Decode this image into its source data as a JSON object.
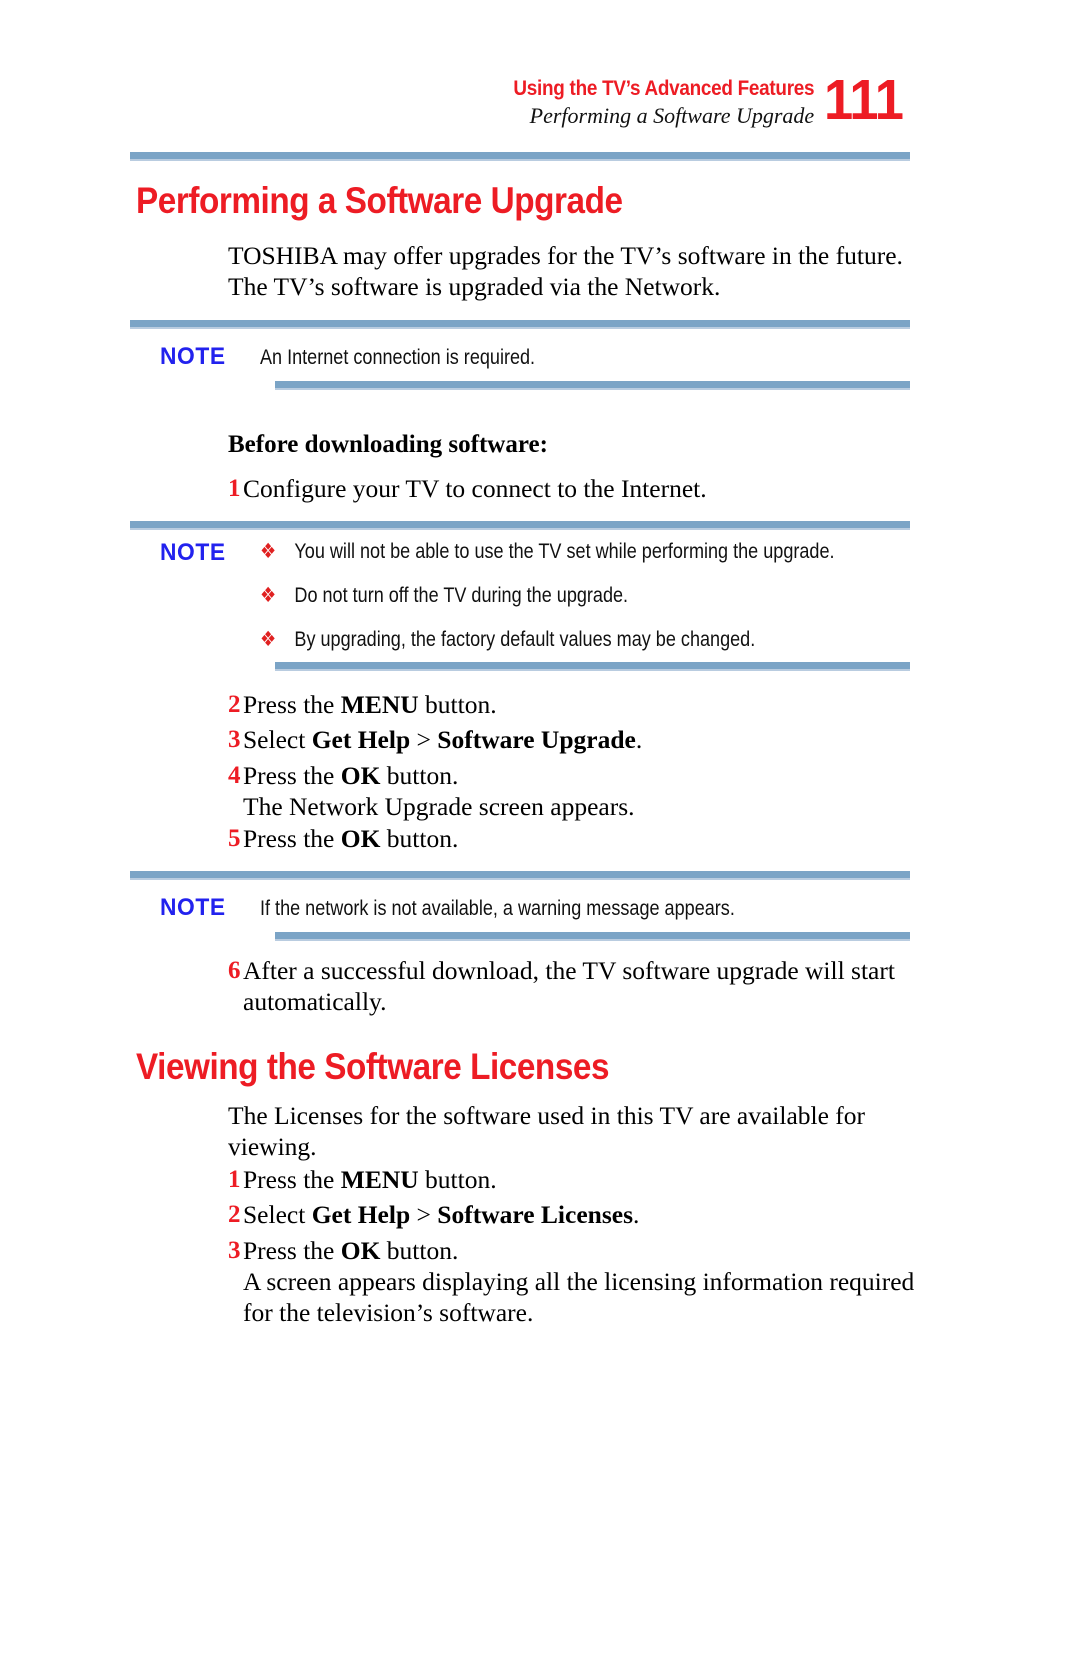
{
  "page": {
    "number": "111",
    "running_head_title": "Using the TV’s Advanced Features",
    "running_head_subtitle": "Performing a Software Upgrade",
    "colors": {
      "accent_red": "#ED1C24",
      "note_blue": "#2222EE",
      "rule_blue": "#7BA4C6",
      "bullet_red": "#E02020"
    }
  },
  "sections": [
    {
      "heading": "Performing a Software Upgrade",
      "intro": "TOSHIBA may offer upgrades for the TV’s software in the future. The TV’s software is upgraded via the Network.",
      "note1": {
        "label": "NOTE",
        "text": "An Internet connection is required."
      },
      "subhead": "Before downloading software:",
      "step1": {
        "num": "1",
        "text": "Configure your TV to connect to the Internet."
      },
      "note2": {
        "label": "NOTE",
        "bullet_glyph": "❖",
        "bullets": [
          "You will not be able to use the TV set while performing the upgrade.",
          "Do not turn off the TV during the upgrade.",
          "By upgrading, the factory default values may be changed."
        ]
      },
      "steps_mid": [
        {
          "num": "2",
          "pre": "Press the ",
          "bold": "MENU",
          "post": " button.",
          "extra": ""
        },
        {
          "num": "3",
          "pre": "Select ",
          "bold": "Get Help",
          "mid": " > ",
          "bold2": "Software Upgrade",
          "post": ".",
          "extra": ""
        },
        {
          "num": "4",
          "pre": "Press the ",
          "bold": "OK",
          "post": " button.",
          "extra": "The Network Upgrade screen appears."
        },
        {
          "num": "5",
          "pre": "Press the ",
          "bold": "OK",
          "post": " button.",
          "extra": ""
        }
      ],
      "note3": {
        "label": "NOTE",
        "text": "If the network is not available, a warning message appears."
      },
      "step6": {
        "num": "6",
        "text": "After a successful download, the TV software upgrade will start automatically."
      }
    },
    {
      "heading": "Viewing the Software Licenses",
      "intro": "The Licenses for the software used in this TV are available for viewing.",
      "steps": [
        {
          "num": "1",
          "pre": "Press the ",
          "bold": "MENU",
          "post": " button.",
          "extra": ""
        },
        {
          "num": "2",
          "pre": "Select ",
          "bold": "Get Help",
          "mid": " > ",
          "bold2": "Software Licenses",
          "post": ".",
          "extra": ""
        },
        {
          "num": "3",
          "pre": "Press the ",
          "bold": "OK",
          "post": " button.",
          "extra": "A screen appears displaying all the licensing information required for the television’s software."
        }
      ]
    }
  ]
}
